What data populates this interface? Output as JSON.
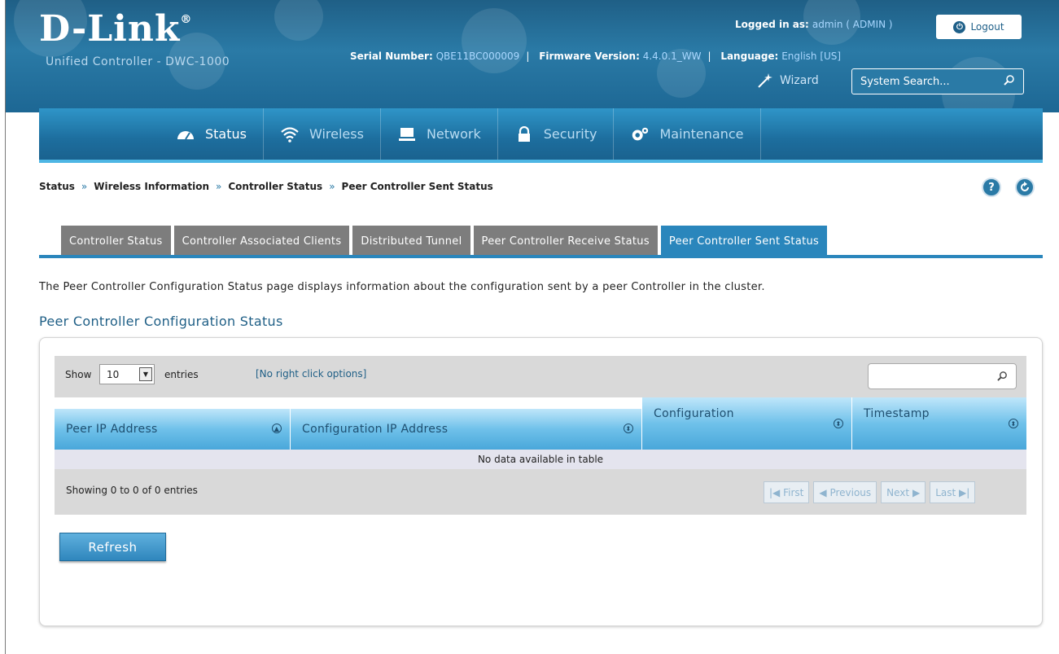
{
  "header": {
    "brand": "D-Link",
    "trademark": "®",
    "product": "Unified Controller - DWC-1000",
    "logged_in_label": "Logged in as:",
    "logged_in_value": "admin ( ADMIN )",
    "logout_label": "Logout",
    "serial_label": "Serial Number:",
    "serial_value": "QBE11BC000009",
    "firmware_label": "Firmware Version:",
    "firmware_value": "4.4.0.1_WW",
    "language_label": "Language:",
    "language_value": "English [US]",
    "wizard_label": "Wizard",
    "search_placeholder": "System Search..."
  },
  "nav": {
    "items": [
      {
        "label": "Status",
        "icon": "speedometer-icon"
      },
      {
        "label": "Wireless",
        "icon": "wifi-icon"
      },
      {
        "label": "Network",
        "icon": "monitor-icon"
      },
      {
        "label": "Security",
        "icon": "lock-icon"
      },
      {
        "label": "Maintenance",
        "icon": "gears-icon"
      }
    ]
  },
  "breadcrumb": {
    "items": [
      "Status",
      "Wireless Information",
      "Controller Status",
      "Peer Controller Sent Status"
    ],
    "separator": "»"
  },
  "tabs": [
    "Controller Status",
    "Controller Associated Clients",
    "Distributed Tunnel",
    "Peer Controller Receive Status",
    "Peer Controller Sent Status"
  ],
  "page": {
    "description": "The Peer Controller Configuration Status page displays information about the configuration sent by a peer Controller in the cluster.",
    "section_title": "Peer Controller Configuration Status"
  },
  "table": {
    "show_label": "Show",
    "entries_value": "10",
    "entries_label": "entries",
    "right_click_note": "[No right click options]",
    "columns": [
      "Peer IP Address",
      "Configuration IP Address",
      "Configuration",
      "Timestamp"
    ],
    "empty_message": "No data available in table",
    "showing": "Showing 0 to 0 of 0 entries",
    "pager": {
      "first": "First",
      "previous": "Previous",
      "next": "Next",
      "last": "Last"
    }
  },
  "buttons": {
    "refresh": "Refresh"
  }
}
